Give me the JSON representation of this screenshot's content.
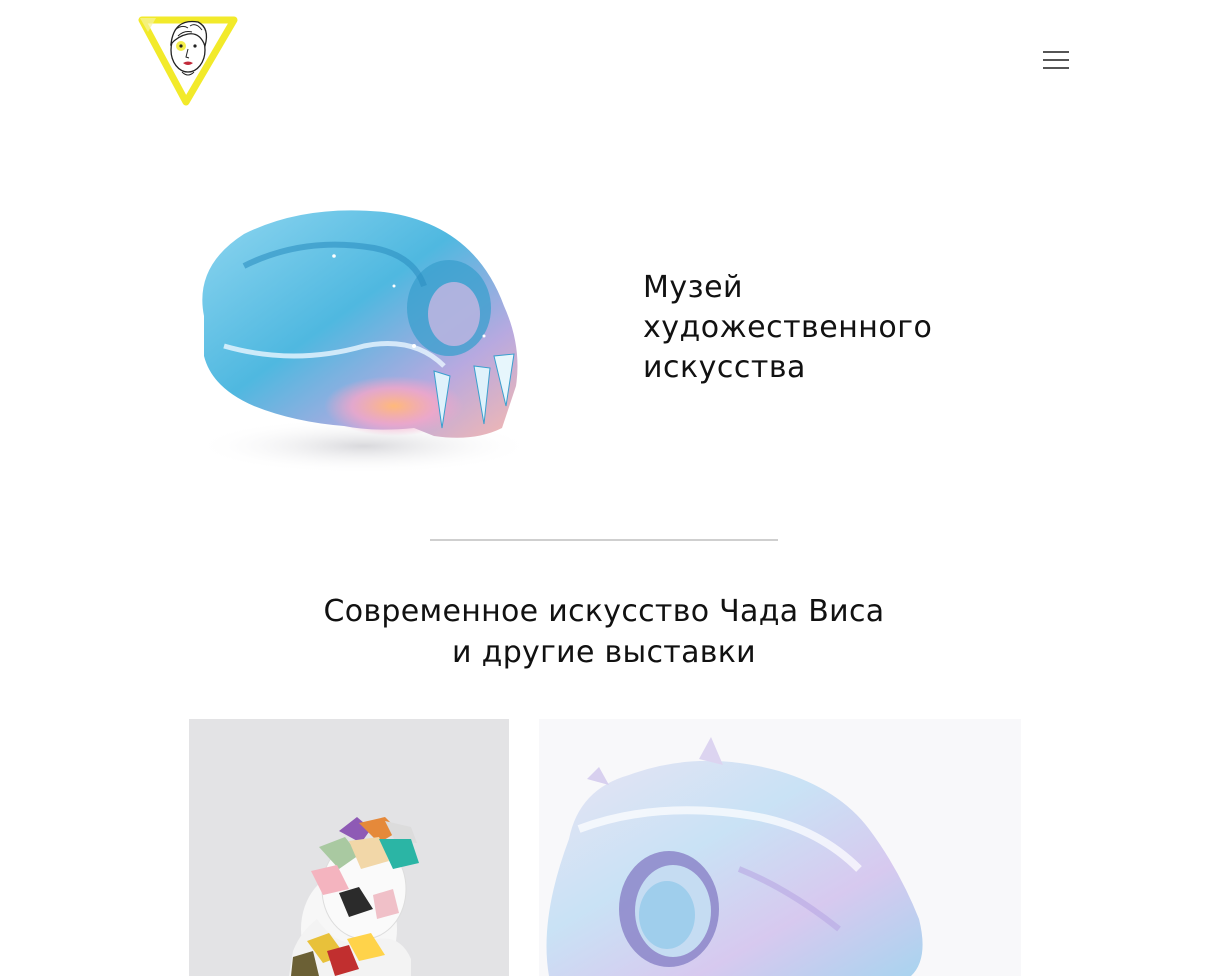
{
  "header": {
    "logo_icon": "museum-logo-icon",
    "menu_icon": "hamburger-menu-icon"
  },
  "hero": {
    "title_line1": "Музей",
    "title_line2": "художественного",
    "title_line3": "искусства",
    "image_icon": "resin-skull-sculpture-image"
  },
  "section": {
    "title_line1": "Современное искусство Чада Виса",
    "title_line2": "и другие выставки"
  },
  "gallery": {
    "items": [
      {
        "image": "crystal-bust-sculpture-image"
      },
      {
        "image": "pastel-skull-sculpture-image"
      }
    ]
  },
  "colors": {
    "logo_accent": "#f2ea2a",
    "skull_blue": "#5ec4e8",
    "divider": "#cfcfcf",
    "text": "#111111"
  }
}
